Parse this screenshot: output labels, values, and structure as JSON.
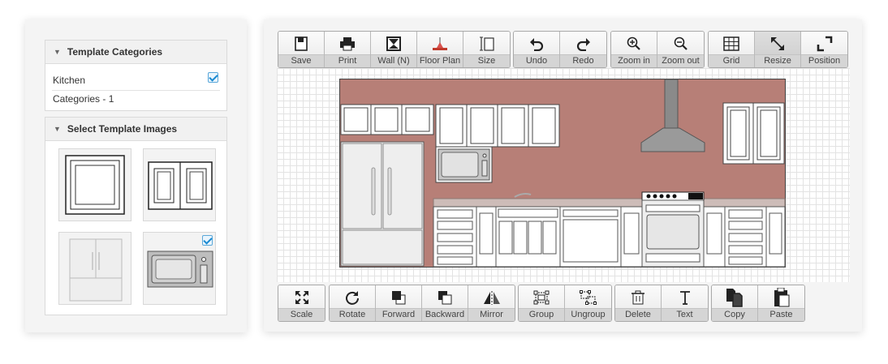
{
  "sidebar": {
    "categories": {
      "title": "Template Categories",
      "items": [
        {
          "label": "Kitchen",
          "checked": true
        },
        {
          "label": "Categories - 1",
          "checked": false
        }
      ]
    },
    "images": {
      "title": "Select Template Images",
      "items": [
        {
          "name": "single-door-cabinet",
          "selected": false
        },
        {
          "name": "double-door-cabinet",
          "selected": false
        },
        {
          "name": "refrigerator",
          "selected": false
        },
        {
          "name": "microwave",
          "selected": true
        }
      ]
    }
  },
  "top_toolbar": {
    "groups": [
      [
        {
          "label": "Save",
          "icon": "save-icon"
        },
        {
          "label": "Print",
          "icon": "print-icon"
        },
        {
          "label": "Wall (N)",
          "icon": "wall-icon"
        },
        {
          "label": "Floor Plan",
          "icon": "floor-plan-icon"
        },
        {
          "label": "Size",
          "icon": "size-icon"
        }
      ],
      [
        {
          "label": "Undo",
          "icon": "undo-icon"
        },
        {
          "label": "Redo",
          "icon": "redo-icon"
        }
      ],
      [
        {
          "label": "Zoom in",
          "icon": "zoom-in-icon"
        },
        {
          "label": "Zoom out",
          "icon": "zoom-out-icon"
        }
      ],
      [
        {
          "label": "Grid",
          "icon": "grid-icon"
        },
        {
          "label": "Resize",
          "icon": "resize-icon",
          "active": true
        },
        {
          "label": "Position",
          "icon": "position-icon"
        }
      ]
    ]
  },
  "bottom_toolbar": {
    "groups": [
      [
        {
          "label": "Scale",
          "icon": "scale-icon"
        }
      ],
      [
        {
          "label": "Rotate",
          "icon": "rotate-icon"
        },
        {
          "label": "Forward",
          "icon": "forward-icon"
        },
        {
          "label": "Backward",
          "icon": "backward-icon"
        },
        {
          "label": "Mirror",
          "icon": "mirror-icon"
        }
      ],
      [
        {
          "label": "Group",
          "icon": "group-icon"
        },
        {
          "label": "Ungroup",
          "icon": "ungroup-icon"
        }
      ],
      [
        {
          "label": "Delete",
          "icon": "delete-icon"
        },
        {
          "label": "Text",
          "icon": "text-icon"
        }
      ],
      [
        {
          "label": "Copy",
          "icon": "copy-icon"
        },
        {
          "label": "Paste",
          "icon": "paste-icon"
        }
      ]
    ]
  },
  "canvas": {
    "wall_color": "#b77f77",
    "counter_color": "#cdbcb8",
    "accent_check_color": "#1a8ad2"
  }
}
